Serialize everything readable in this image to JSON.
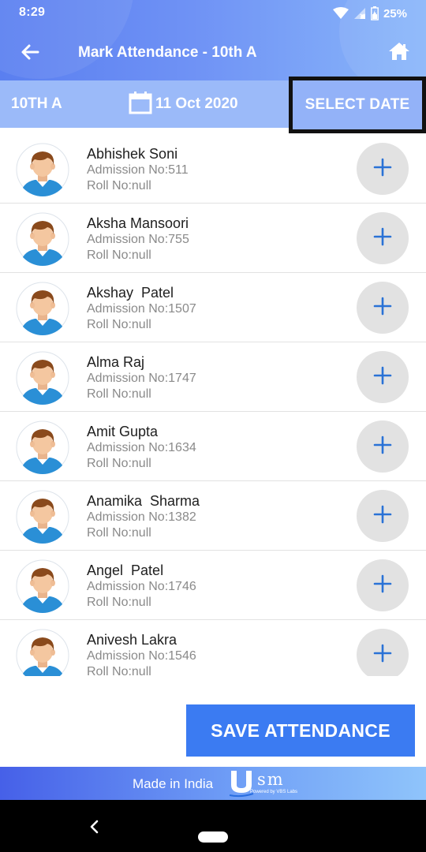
{
  "status_bar": {
    "time": "8:29",
    "battery": "25%"
  },
  "app_bar": {
    "title": "Mark Attendance - 10th A"
  },
  "date_bar": {
    "class_name": "10TH A",
    "date": "11 Oct 2020",
    "select_date_label": "SELECT DATE"
  },
  "students": [
    {
      "name": "Abhishek Soni",
      "admission": "Admission No:511",
      "roll": "Roll No:null"
    },
    {
      "name": "Aksha Mansoori",
      "admission": "Admission No:755",
      "roll": "Roll No:null"
    },
    {
      "name": "Akshay  Patel",
      "admission": "Admission No:1507",
      "roll": "Roll No:null"
    },
    {
      "name": "Alma Raj",
      "admission": "Admission No:1747",
      "roll": "Roll No:null"
    },
    {
      "name": "Amit Gupta",
      "admission": "Admission No:1634",
      "roll": "Roll No:null"
    },
    {
      "name": "Anamika  Sharma",
      "admission": "Admission No:1382",
      "roll": "Roll No:null"
    },
    {
      "name": "Angel  Patel",
      "admission": "Admission No:1746",
      "roll": "Roll No:null"
    },
    {
      "name": "Anivesh Lakra",
      "admission": "Admission No:1546",
      "roll": "Roll No:null"
    }
  ],
  "actions": {
    "save_label": "SAVE ATTENDANCE"
  },
  "footer": {
    "made_in": "Made in India",
    "logo_text": "sm",
    "powered_by": "Powered by VBS Labs"
  },
  "colors": {
    "accent": "#3b7bf2",
    "header_start": "#5a7ff0",
    "add_icon": "#2a72d6"
  },
  "icons": [
    "back-arrow-icon",
    "home-icon",
    "calendar-icon",
    "plus-icon",
    "student-avatar-icon",
    "wifi-icon",
    "signal-icon",
    "battery-icon"
  ]
}
